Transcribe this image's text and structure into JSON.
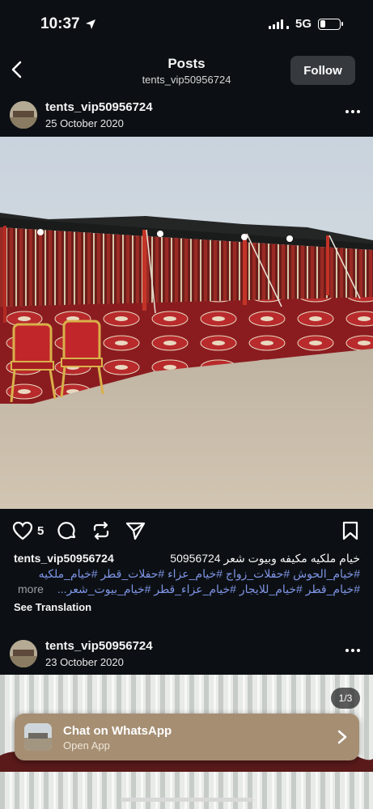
{
  "status_bar": {
    "time": "10:37",
    "network": "5G"
  },
  "header": {
    "title": "Posts",
    "subtitle": "tents_vip50956724",
    "follow_label": "Follow"
  },
  "post1": {
    "username": "tents_vip50956724",
    "date": "25 October 2020",
    "likes": "5",
    "caption_user": "tents_vip50956724",
    "caption_text": "خيام ملكيه مكيفه وبيوت شعر 50956724",
    "hashtags_line1": "#خيام_الحوش #حفلات_زواج #خيام_عزاء #حفلات_قطر #خيام_ملكيه",
    "hashtags_line2": "#خيام_قطر #خيام_للايجار #خيام_عزاء_قطر #خيام_بيوت_شعر...",
    "more_label": "more",
    "see_translation": "See Translation"
  },
  "post2": {
    "username": "tents_vip50956724",
    "date": "23 October 2020",
    "counter": "1/3"
  },
  "whatsapp_banner": {
    "title": "Chat on WhatsApp",
    "subtitle": "Open App"
  },
  "icons": [
    "back-arrow-icon",
    "more-icon",
    "heart-icon",
    "comment-icon",
    "repost-icon",
    "share-icon",
    "bookmark-icon",
    "chevron-right-icon",
    "location-arrow-icon",
    "signal-icon",
    "battery-icon"
  ]
}
